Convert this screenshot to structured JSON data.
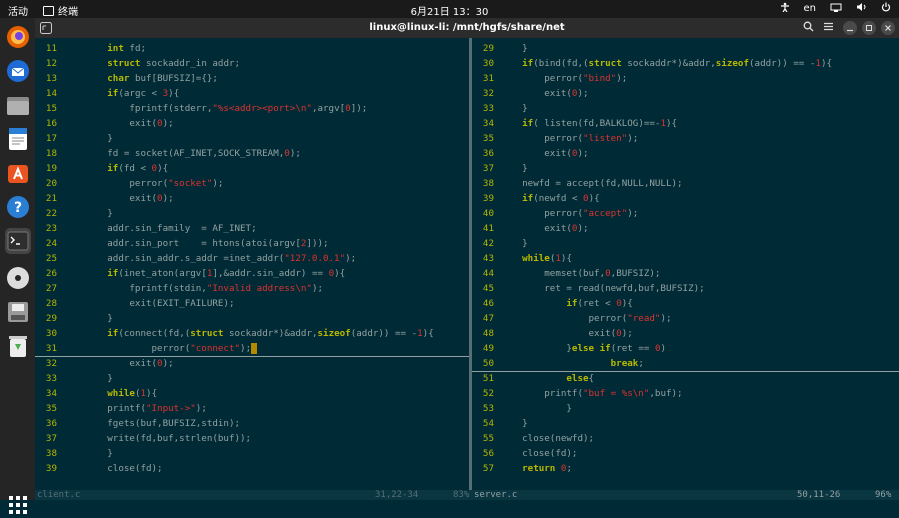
{
  "topbar": {
    "activities": "活动",
    "app_name": "终端",
    "clock": "6月21日  13：30",
    "lang": "en"
  },
  "dock": {
    "tooltip": "终端",
    "apps": [
      {
        "name": "firefox",
        "color": "#e66000"
      },
      {
        "name": "thunderbird",
        "color": "#1f6bd6"
      },
      {
        "name": "files",
        "color": "#8a8a8a"
      },
      {
        "name": "writer",
        "color": "#2a7fd4"
      },
      {
        "name": "software",
        "color": "#e95420"
      },
      {
        "name": "help",
        "color": "#2a7fd4"
      },
      {
        "name": "terminal",
        "color": "#3a3a3a"
      },
      {
        "name": "disc",
        "color": "#dddddd"
      },
      {
        "name": "save",
        "color": "#9a9a9a"
      },
      {
        "name": "trash",
        "color": "#4caf50"
      }
    ]
  },
  "window": {
    "title": "linux@linux-li: /mnt/hgfs/share/net"
  },
  "editor": {
    "left_lines": [
      {
        "n": "11",
        "code": "        int fd;"
      },
      {
        "n": "12",
        "code": "        struct sockaddr_in addr;"
      },
      {
        "n": "13",
        "code": "        char buf[BUFSIZ]={};"
      },
      {
        "n": "14",
        "code": "        if(argc < 3){"
      },
      {
        "n": "15",
        "code": "            fprintf(stderr,\"%s<addr><port>\\n\",argv[0]);"
      },
      {
        "n": "16",
        "code": "            exit(0);"
      },
      {
        "n": "17",
        "code": "        }"
      },
      {
        "n": "18",
        "code": "        fd = socket(AF_INET,SOCK_STREAM,0);"
      },
      {
        "n": "19",
        "code": "        if(fd < 0){"
      },
      {
        "n": "20",
        "code": "            perror(\"socket\");"
      },
      {
        "n": "21",
        "code": "            exit(0);"
      },
      {
        "n": "22",
        "code": "        }"
      },
      {
        "n": "23",
        "code": "        addr.sin_family  = AF_INET;"
      },
      {
        "n": "24",
        "code": "        addr.sin_port    = htons(atoi(argv[2]));"
      },
      {
        "n": "25",
        "code": "        addr.sin_addr.s_addr =inet_addr(\"127.0.0.1\");"
      },
      {
        "n": "26",
        "code": "        if(inet_aton(argv[1],&addr.sin_addr) == 0){"
      },
      {
        "n": "27",
        "code": "            fprintf(stdin,\"Invalid address\\n\");"
      },
      {
        "n": "28",
        "code": "            exit(EXIT_FAILURE);"
      },
      {
        "n": "29",
        "code": "        }"
      },
      {
        "n": "30",
        "code": "        if(connect(fd,(struct sockaddr*)&addr,sizeof(addr)) == -1){"
      },
      {
        "n": "31",
        "code": "                perror(\"connect\");"
      },
      {
        "n": "32",
        "code": "            exit(0);"
      },
      {
        "n": "33",
        "code": "        }"
      },
      {
        "n": "34",
        "code": "        while(1){"
      },
      {
        "n": "35",
        "code": "        printf(\"Input->\");"
      },
      {
        "n": "36",
        "code": "        fgets(buf,BUFSIZ,stdin);"
      },
      {
        "n": "37",
        "code": "        write(fd,buf,strlen(buf));"
      },
      {
        "n": "38",
        "code": "        }"
      },
      {
        "n": "39",
        "code": "        close(fd);"
      }
    ],
    "right_lines": [
      {
        "n": "29",
        "code": "    }"
      },
      {
        "n": "30",
        "code": "    if(bind(fd,(struct sockaddr*)&addr,sizeof(addr)) == -1){"
      },
      {
        "n": "31",
        "code": "        perror(\"bind\");"
      },
      {
        "n": "32",
        "code": "        exit(0);"
      },
      {
        "n": "33",
        "code": "    }"
      },
      {
        "n": "34",
        "code": "    if( listen(fd,BALKLOG)==-1){"
      },
      {
        "n": "35",
        "code": "        perror(\"listen\");"
      },
      {
        "n": "36",
        "code": "        exit(0);"
      },
      {
        "n": "37",
        "code": "    }"
      },
      {
        "n": "38",
        "code": "    newfd = accept(fd,NULL,NULL);"
      },
      {
        "n": "39",
        "code": "    if(newfd < 0){"
      },
      {
        "n": "40",
        "code": "        perror(\"accept\");"
      },
      {
        "n": "41",
        "code": "        exit(0);"
      },
      {
        "n": "42",
        "code": "    }"
      },
      {
        "n": "43",
        "code": "    while(1){"
      },
      {
        "n": "44",
        "code": "        memset(buf,0,BUFSIZ);"
      },
      {
        "n": "45",
        "code": "        ret = read(newfd,buf,BUFSIZ);"
      },
      {
        "n": "46",
        "code": "            if(ret < 0){"
      },
      {
        "n": "47",
        "code": "                perror(\"read\");"
      },
      {
        "n": "48",
        "code": "                exit(0);"
      },
      {
        "n": "49",
        "code": "            }else if(ret == 0)"
      },
      {
        "n": "50",
        "code": "                    break;"
      },
      {
        "n": "51",
        "code": "            else{"
      },
      {
        "n": "52",
        "code": "        printf(\"buf = %s\\n\",buf);"
      },
      {
        "n": "53",
        "code": "            }"
      },
      {
        "n": "54",
        "code": "    }"
      },
      {
        "n": "55",
        "code": "    close(newfd);"
      },
      {
        "n": "56",
        "code": "    close(fd);"
      },
      {
        "n": "57",
        "code": "    return 0;"
      }
    ],
    "left_cursor_line": "31",
    "right_cursor_line": "50"
  },
  "statusline": {
    "left_file": "client.c",
    "left_pos": "31,22-34",
    "left_pct": "83%",
    "right_file": "server.c",
    "right_pos": "50,11-26",
    "right_pct": "96%"
  },
  "colors": {
    "bg": "#002b36",
    "line_number": "#b5b500",
    "keyword": "#b8b800",
    "string": "#dc322f",
    "text": "#93a1a1"
  }
}
